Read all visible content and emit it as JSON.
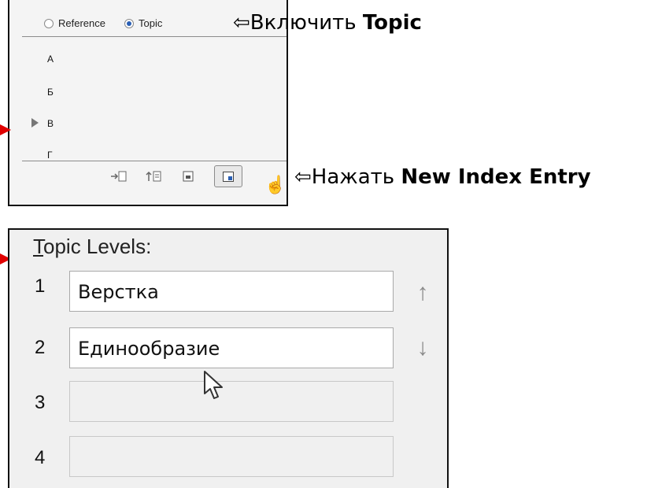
{
  "index_panel": {
    "radio_reference": "Reference",
    "radio_topic": "Topic",
    "selected": "Topic",
    "letters": [
      "А",
      "Б",
      "В",
      "Г"
    ],
    "expanded_letter": "В",
    "footer_icons": [
      "go-to-selected-marker-icon",
      "update-preview-icon",
      "generate-index-icon",
      "new-index-entry-icon"
    ]
  },
  "annotations": {
    "topic_prefix": "⇦Включить ",
    "topic_bold": "Topic",
    "new_entry_prefix": "⇦Нажать ",
    "new_entry_bold": "New Index Entry",
    "arrow_color": "#e00000"
  },
  "topic_levels": {
    "label_underlined": "T",
    "label_rest": "opic Levels:",
    "levels": [
      {
        "num": "1",
        "value": "Верстка"
      },
      {
        "num": "2",
        "value": "Единообразие"
      },
      {
        "num": "3",
        "value": ""
      },
      {
        "num": "4",
        "value": ""
      }
    ],
    "up_icon": "↑",
    "down_icon": "↓"
  }
}
